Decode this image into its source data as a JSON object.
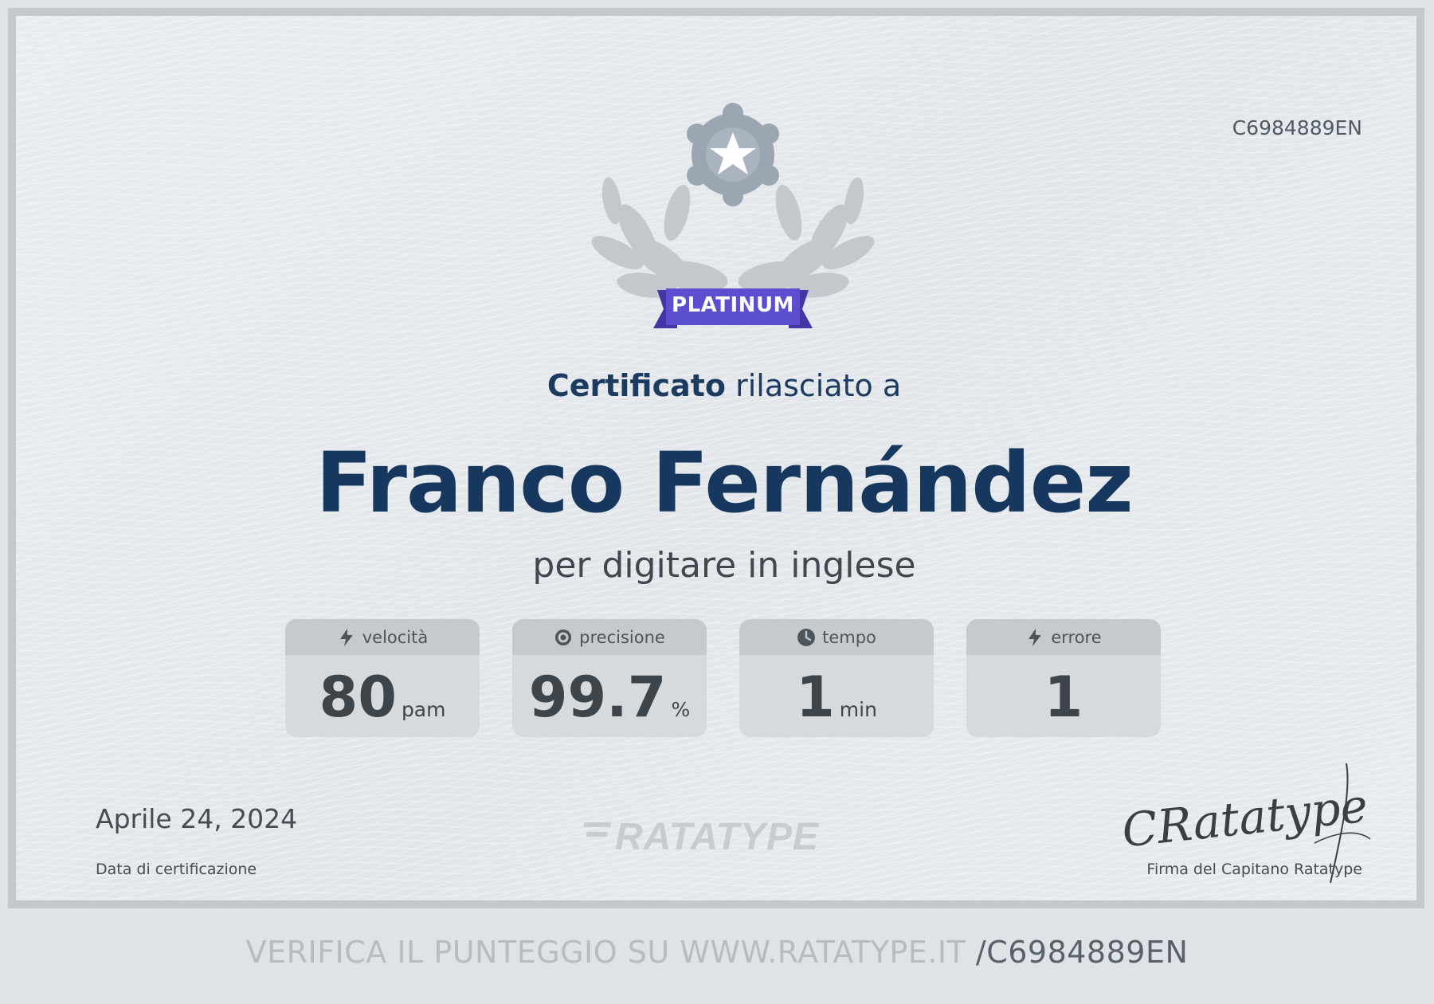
{
  "certificate": {
    "id": "C6984889EN",
    "badge_label": "PLATINUM",
    "issued_bold": "Certificato",
    "issued_rest": " rilasciato a",
    "recipient": "Franco Fernández",
    "subtitle": "per digitare in inglese",
    "date": "Aprile 24, 2024",
    "date_label": "Data di certificazione",
    "logo_text": "RATATYPE",
    "signature_text": "CRatatype",
    "signature_label": "Firma del Capitano Ratatype"
  },
  "stats": [
    {
      "label": "velocità",
      "icon": "lightning-icon",
      "value": "80",
      "unit": "pam"
    },
    {
      "label": "precisione",
      "icon": "target-icon",
      "value": "99.7",
      "unit": "%"
    },
    {
      "label": "tempo",
      "icon": "clock-icon",
      "value": "1",
      "unit": "min"
    },
    {
      "label": "errore",
      "icon": "lightning-icon",
      "value": "1",
      "unit": ""
    }
  ],
  "footer": {
    "verify_text": "VERIFICA IL PUNTEGGIO SU WWW.RATATYPE.IT ",
    "verify_code": "/C6984889EN"
  },
  "colors": {
    "badge_ribbon": "#5b4fd0",
    "badge_star": "#9aa6b1",
    "laurel": "#c4c8cc",
    "name": "#17385e"
  }
}
